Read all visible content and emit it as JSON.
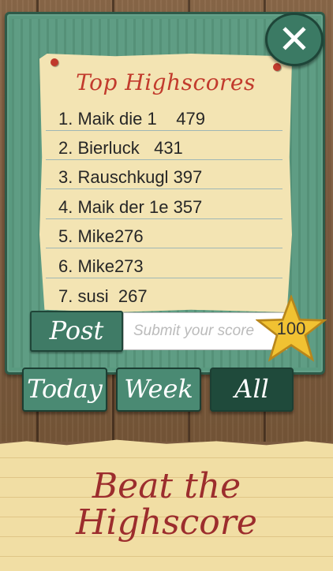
{
  "title": "Top Highscores",
  "entries": [
    {
      "rank": "1.",
      "name": "Maik die 1",
      "score": "479"
    },
    {
      "rank": "2.",
      "name": "Bierluck",
      "score": "431"
    },
    {
      "rank": "3.",
      "name": "Rauschkugl",
      "score": "397"
    },
    {
      "rank": "4.",
      "name": "Maik der 1e",
      "score": "357"
    },
    {
      "rank": "5.",
      "name": "Mike",
      "score": "276"
    },
    {
      "rank": "6.",
      "name": "Mike",
      "score": "273"
    },
    {
      "rank": "7.",
      "name": "susi",
      "score": "267"
    }
  ],
  "post": {
    "label": "Post",
    "placeholder": "Submit your score",
    "current_score": "100"
  },
  "tabs": [
    {
      "label": "Today",
      "active": false
    },
    {
      "label": "Week",
      "active": false
    },
    {
      "label": "All",
      "active": true
    }
  ],
  "close_icon": "close-icon",
  "footer": {
    "line1": "Beat the",
    "line2": "Highscore"
  },
  "colors": {
    "board": "#5a9a80",
    "paper": "#f3e4b3",
    "title": "#c23b2d",
    "button": "#3f7b66",
    "active_tab": "#1f4a3b",
    "star": "#f1c232"
  }
}
